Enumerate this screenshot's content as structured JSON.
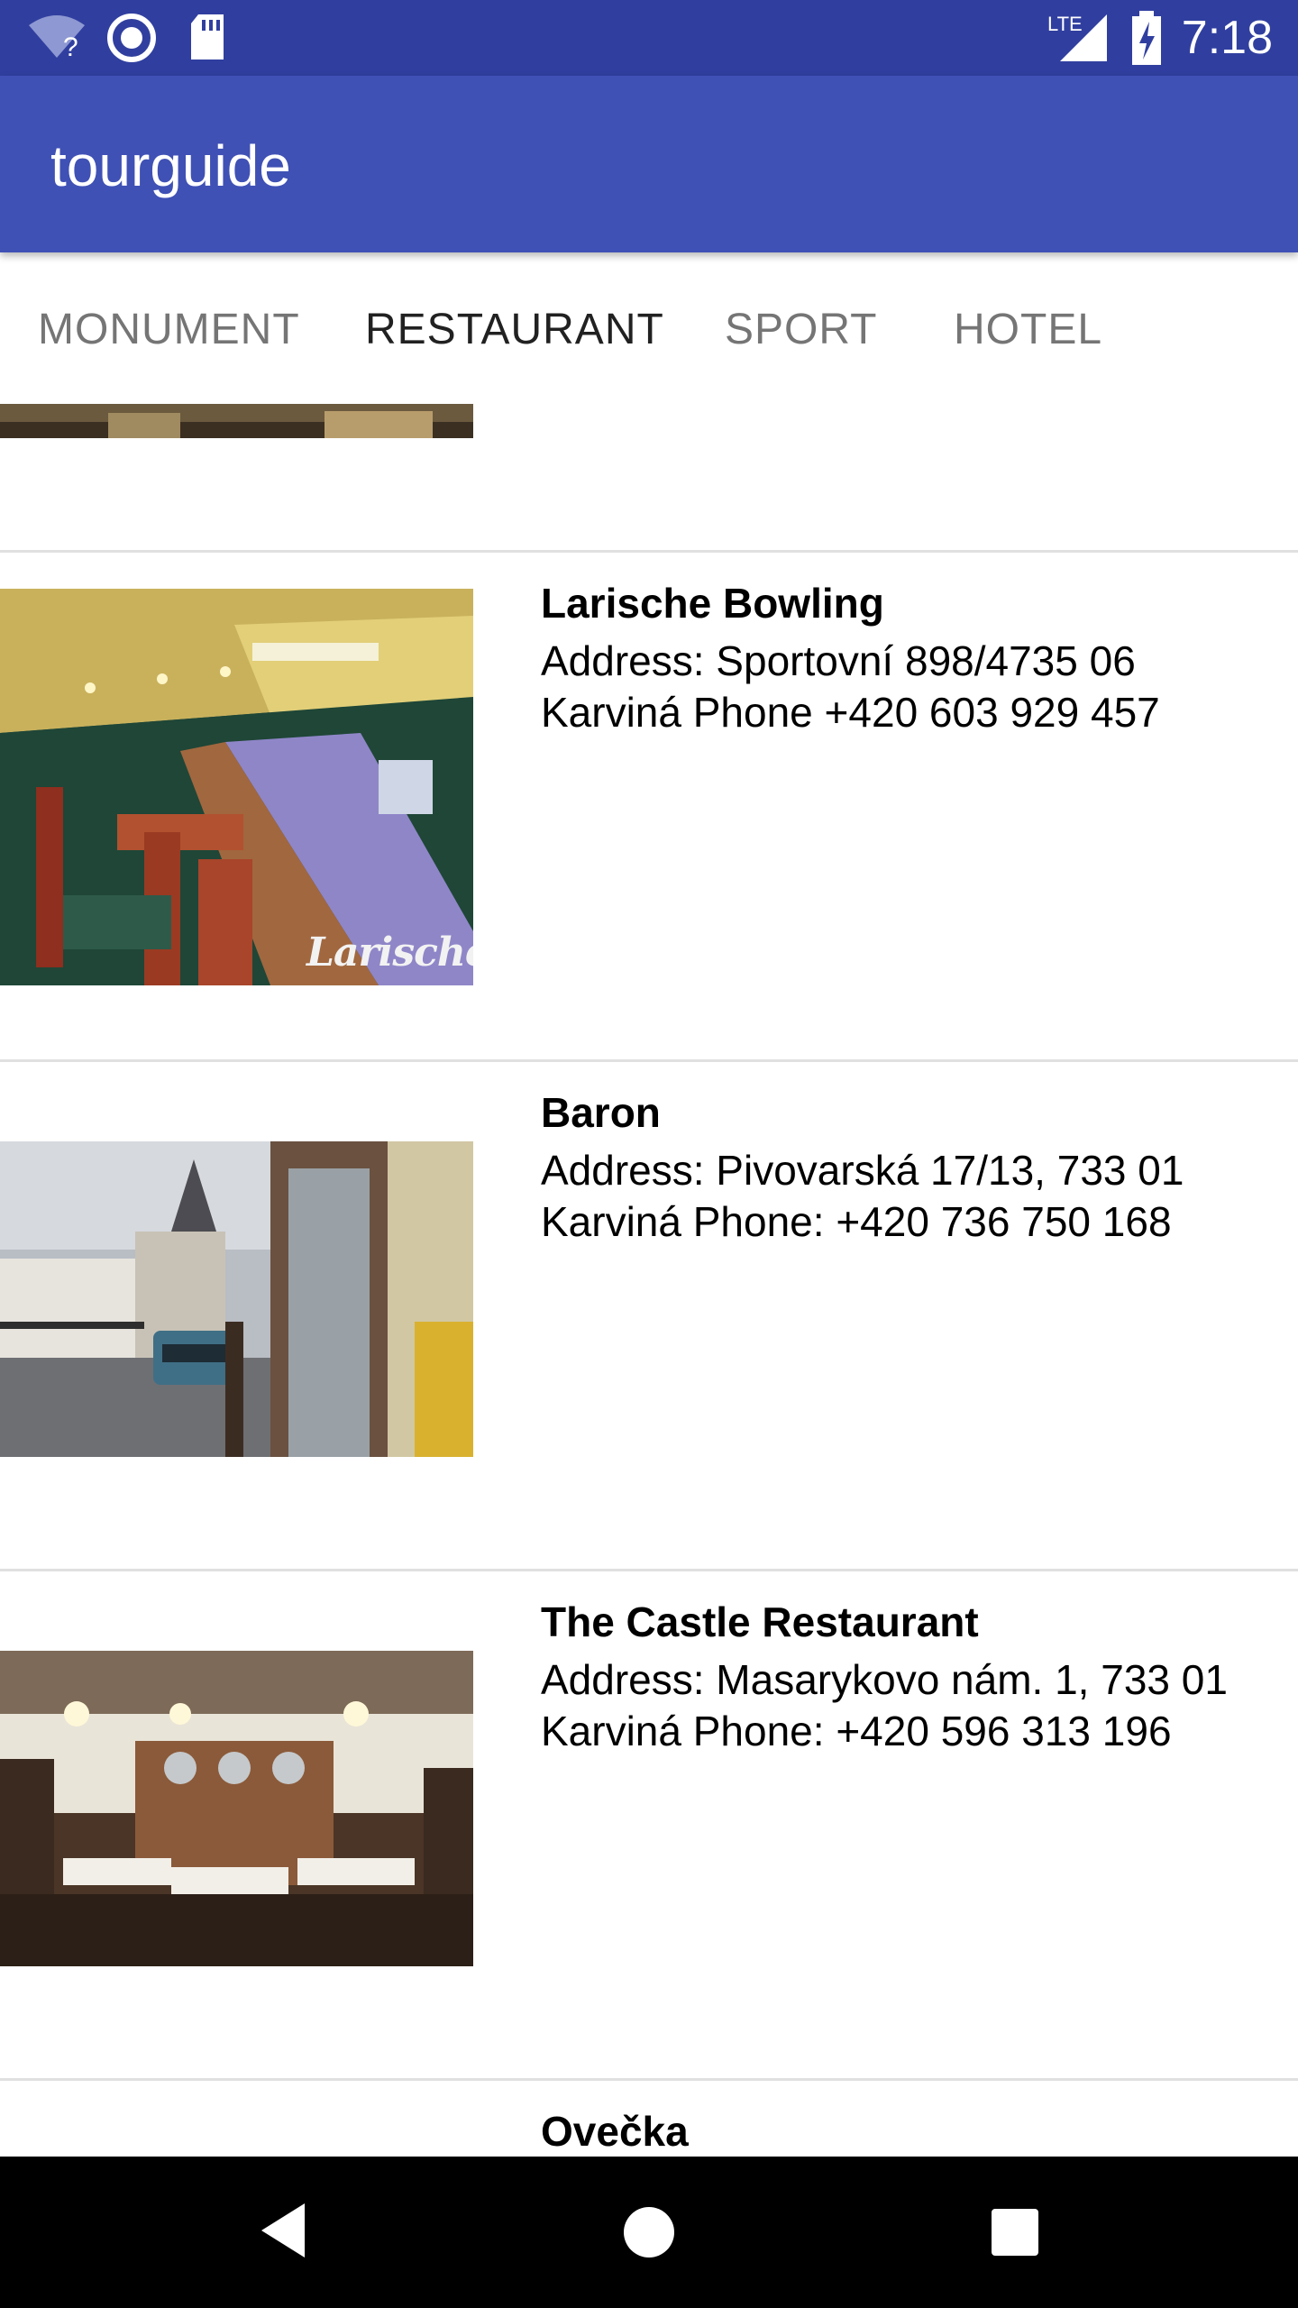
{
  "status_bar": {
    "time": "7:18",
    "network_label": "LTE",
    "icons": [
      "wifi-unknown-icon",
      "sync-icon",
      "sd-card-icon",
      "signal-icon",
      "battery-charging-icon"
    ]
  },
  "app_bar": {
    "title": "tourguide",
    "color": "#3f51b5"
  },
  "tabs": [
    {
      "label": "MONUMENT",
      "selected": false
    },
    {
      "label": "RESTAURANT",
      "selected": true
    },
    {
      "label": "SPORT",
      "selected": false
    },
    {
      "label": "HOTEL",
      "selected": false
    }
  ],
  "places": [
    {
      "name": "Larische Bowling",
      "details": "Address: Sportovní 898/4735 06 Karviná Phone +420 603 929 457",
      "image": "bowling-interior-photo",
      "image_caption": "Larische Bowling"
    },
    {
      "name": "Baron",
      "details": "Address: Pivovarská 17/13, 733 01 Karviná Phone: +420 736 750 168",
      "image": "street-church-photo"
    },
    {
      "name": "The Castle Restaurant",
      "details": "Address: Masarykovo nám. 1, 733 01 Karviná Phone: +420 596 313 196",
      "image": "castle-restaurant-interior-photo"
    },
    {
      "name": "Ovečka",
      "details": "",
      "image": ""
    }
  ],
  "nav_bar": {
    "buttons": [
      "back-icon",
      "home-icon",
      "recents-icon"
    ]
  }
}
